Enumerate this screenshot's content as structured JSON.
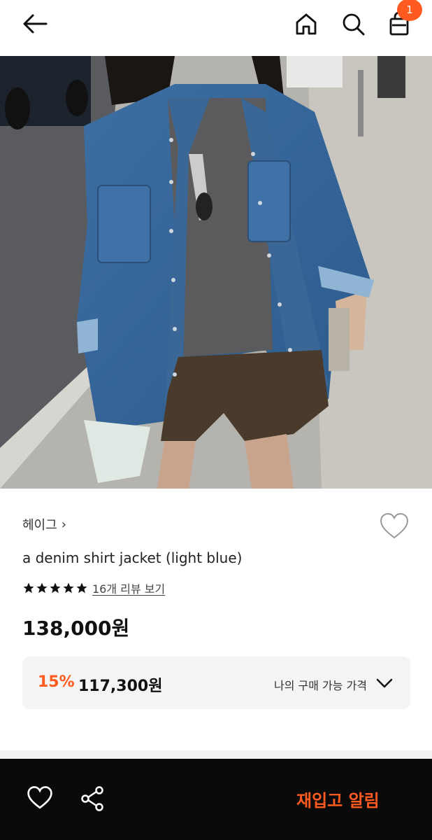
{
  "header": {
    "back_icon": "arrow-left-icon",
    "home_icon": "home-icon",
    "search_icon": "search-icon",
    "cart_icon": "shopping-bag-icon",
    "cart_count": "1"
  },
  "product": {
    "brand": "헤이그",
    "brand_chevron": "›",
    "title": "a denim shirt jacket (light blue)",
    "rating_stars": 5,
    "review_link": "16개 리뷰 보기",
    "price": "138,000원"
  },
  "my_price": {
    "discount": "15%",
    "sale_price": "117,300원",
    "label": "나의 구매 가능 가격"
  },
  "bottom_bar": {
    "wish_icon": "heart-icon",
    "share_icon": "share-icon",
    "restock_label": "재입고 알림"
  },
  "colors": {
    "accent": "#ff5a1f",
    "bottom_bar_bg": "#0a0a0a",
    "price_box_bg": "#f4f4f4"
  }
}
